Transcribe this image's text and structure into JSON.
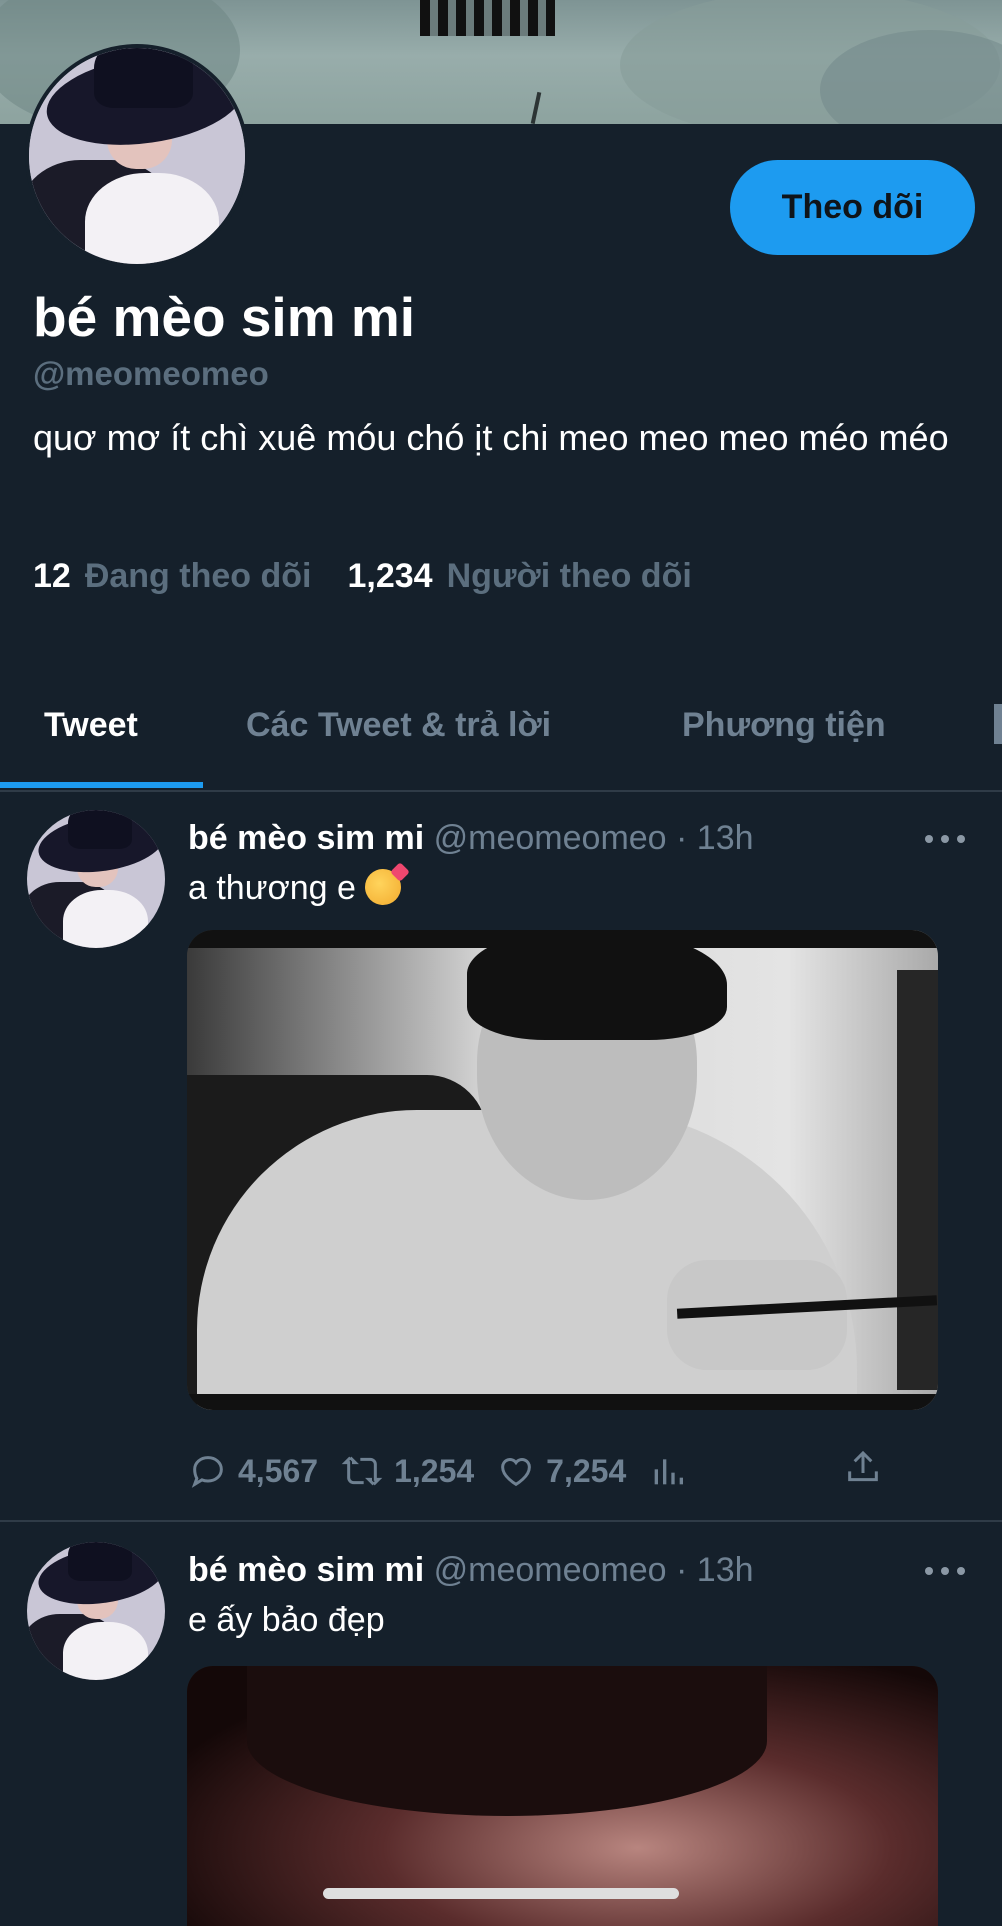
{
  "profile": {
    "follow_label": "Theo dõi",
    "name": "bé mèo sim mi",
    "handle": "@meomeomeo",
    "bio": "quơ mơ ít chì xuê móu chó ịt chi meo meo meo méo méo",
    "following_count": "12",
    "following_label": "Đang theo dõi",
    "followers_count": "1,234",
    "followers_label": "Người theo dõi"
  },
  "tabs": [
    {
      "label": "Tweet",
      "active": true
    },
    {
      "label": "Các Tweet & trả lời",
      "active": false
    },
    {
      "label": "Phương tiện",
      "active": false
    }
  ],
  "tweets": [
    {
      "name": "bé mèo sim mi",
      "meta": "@meomeomeo · 13h",
      "text": "a thương e",
      "emoji": "smiling-face-with-hearts",
      "replies": "4,567",
      "retweets": "1,254",
      "likes": "7,254"
    },
    {
      "name": "bé mèo sim mi",
      "meta": "@meomeomeo · 13h",
      "text": "e ấy bảo đẹp"
    }
  ],
  "colors": {
    "background": "#15202b",
    "accent": "#1d9bf0",
    "muted": "#6f8192"
  }
}
